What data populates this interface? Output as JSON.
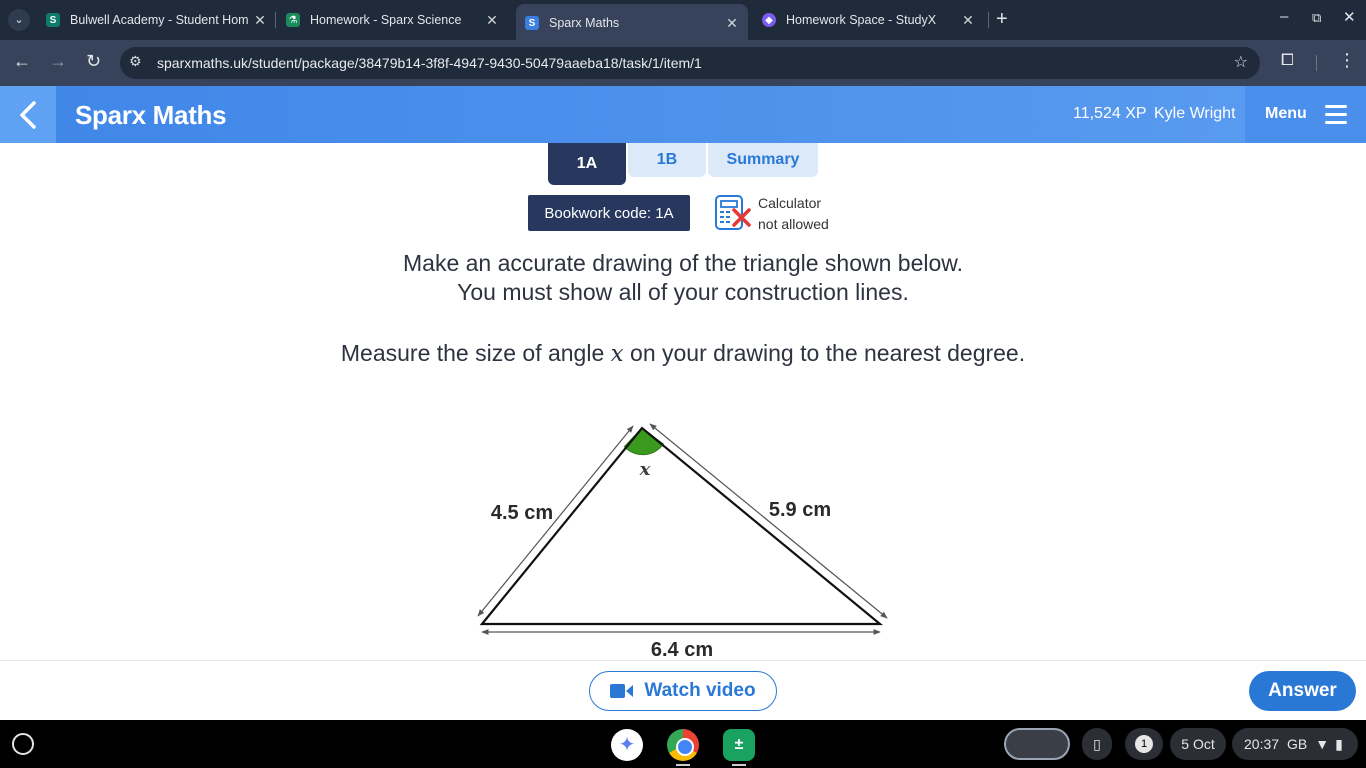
{
  "browser": {
    "tabs": [
      {
        "title": "Bulwell Academy - Student Hom",
        "favicon": "sharepoint-icon",
        "active": false
      },
      {
        "title": "Homework - Sparx Science",
        "favicon": "sparx-science-icon",
        "active": false
      },
      {
        "title": "Sparx Maths",
        "favicon": "sparx-maths-icon",
        "active": true
      },
      {
        "title": "Homework Space - StudyX",
        "favicon": "studyx-icon",
        "active": false
      }
    ],
    "url": "sparxmaths.uk/student/package/38479b14-3f8f-4947-9430-50479aaeba18/task/1/item/1"
  },
  "header": {
    "brand": "Sparx Maths",
    "xp": "11,524 XP",
    "user_name": "Kyle Wright",
    "menu_label": "Menu"
  },
  "question_tabs": [
    {
      "label": "1A",
      "active": true
    },
    {
      "label": "1B",
      "active": false
    },
    {
      "label": "Summary",
      "active": false
    }
  ],
  "bookwork_code": "Bookwork code: 1A",
  "calculator": {
    "line1": "Calculator",
    "line2": "not allowed"
  },
  "question": {
    "line1": "Make an accurate drawing of the triangle shown below.",
    "line2": "You must show all of your construction lines.",
    "line3_before": "Measure the size of angle ",
    "line3_var": "x",
    "line3_after": " on your drawing to the nearest degree."
  },
  "figure": {
    "angle_label": "x",
    "left_side": "4.5 cm",
    "right_side": "5.9 cm",
    "base": "6.4 cm",
    "angle_fill_color": "#3a9a1e"
  },
  "buttons": {
    "watch_video": "Watch video",
    "answer": "Answer"
  },
  "shelf": {
    "notification_count": "1",
    "date": "5 Oct",
    "time": "20:37",
    "locale": "GB"
  },
  "colors": {
    "brand_blue": "#2a78d6",
    "navy": "#27375e",
    "tab_light": "#dce9f9"
  }
}
